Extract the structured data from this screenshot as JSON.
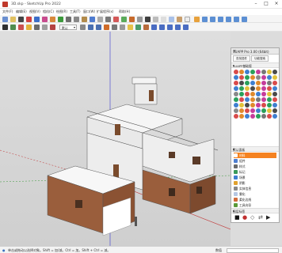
{
  "window": {
    "title": "3D.skp - SketchUp Pro 2022",
    "minimize": "–",
    "maximize": "□",
    "close": "×"
  },
  "menu": [
    "文件(F)",
    "编辑(E)",
    "视图(V)",
    "相机(C)",
    "绘图(R)",
    "工具(T)",
    "窗口(W)",
    "扩展程序(x)",
    "帮助(H)"
  ],
  "toolbar": {
    "layers_dropdown": "默认"
  },
  "panel": {
    "title": "SUAPP Pro 3.00 (64bit)",
    "close": "×",
    "tab_left": "查找插件",
    "tab_right": "功能搜索",
    "section1": "SUAPP基础版",
    "section1_arrow": "▸",
    "section2": "默认面板",
    "section2_arrow": "▸",
    "section3": "图层标签",
    "section3_arrow": "▸",
    "items": [
      {
        "label": "材料",
        "selected": true
      },
      {
        "label": "组件",
        "selected": false
      },
      {
        "label": "样式",
        "selected": false
      },
      {
        "label": "标记",
        "selected": false
      },
      {
        "label": "场景",
        "selected": false
      },
      {
        "label": "阴影",
        "selected": false
      },
      {
        "label": "实体信息",
        "selected": false
      },
      {
        "label": "雾化",
        "selected": false
      },
      {
        "label": "柔化边线",
        "selected": false
      },
      {
        "label": "工具向导",
        "selected": false
      }
    ]
  },
  "status": {
    "text": "单击或拖动以选择对象。Shift = 加/减。Ctrl = 加。Shift + Ctrl = 减。",
    "measure_label": "数值"
  },
  "colors": {
    "accent": "#f58220",
    "brick": "#8b5a3c",
    "wall": "#f2f2f2"
  }
}
